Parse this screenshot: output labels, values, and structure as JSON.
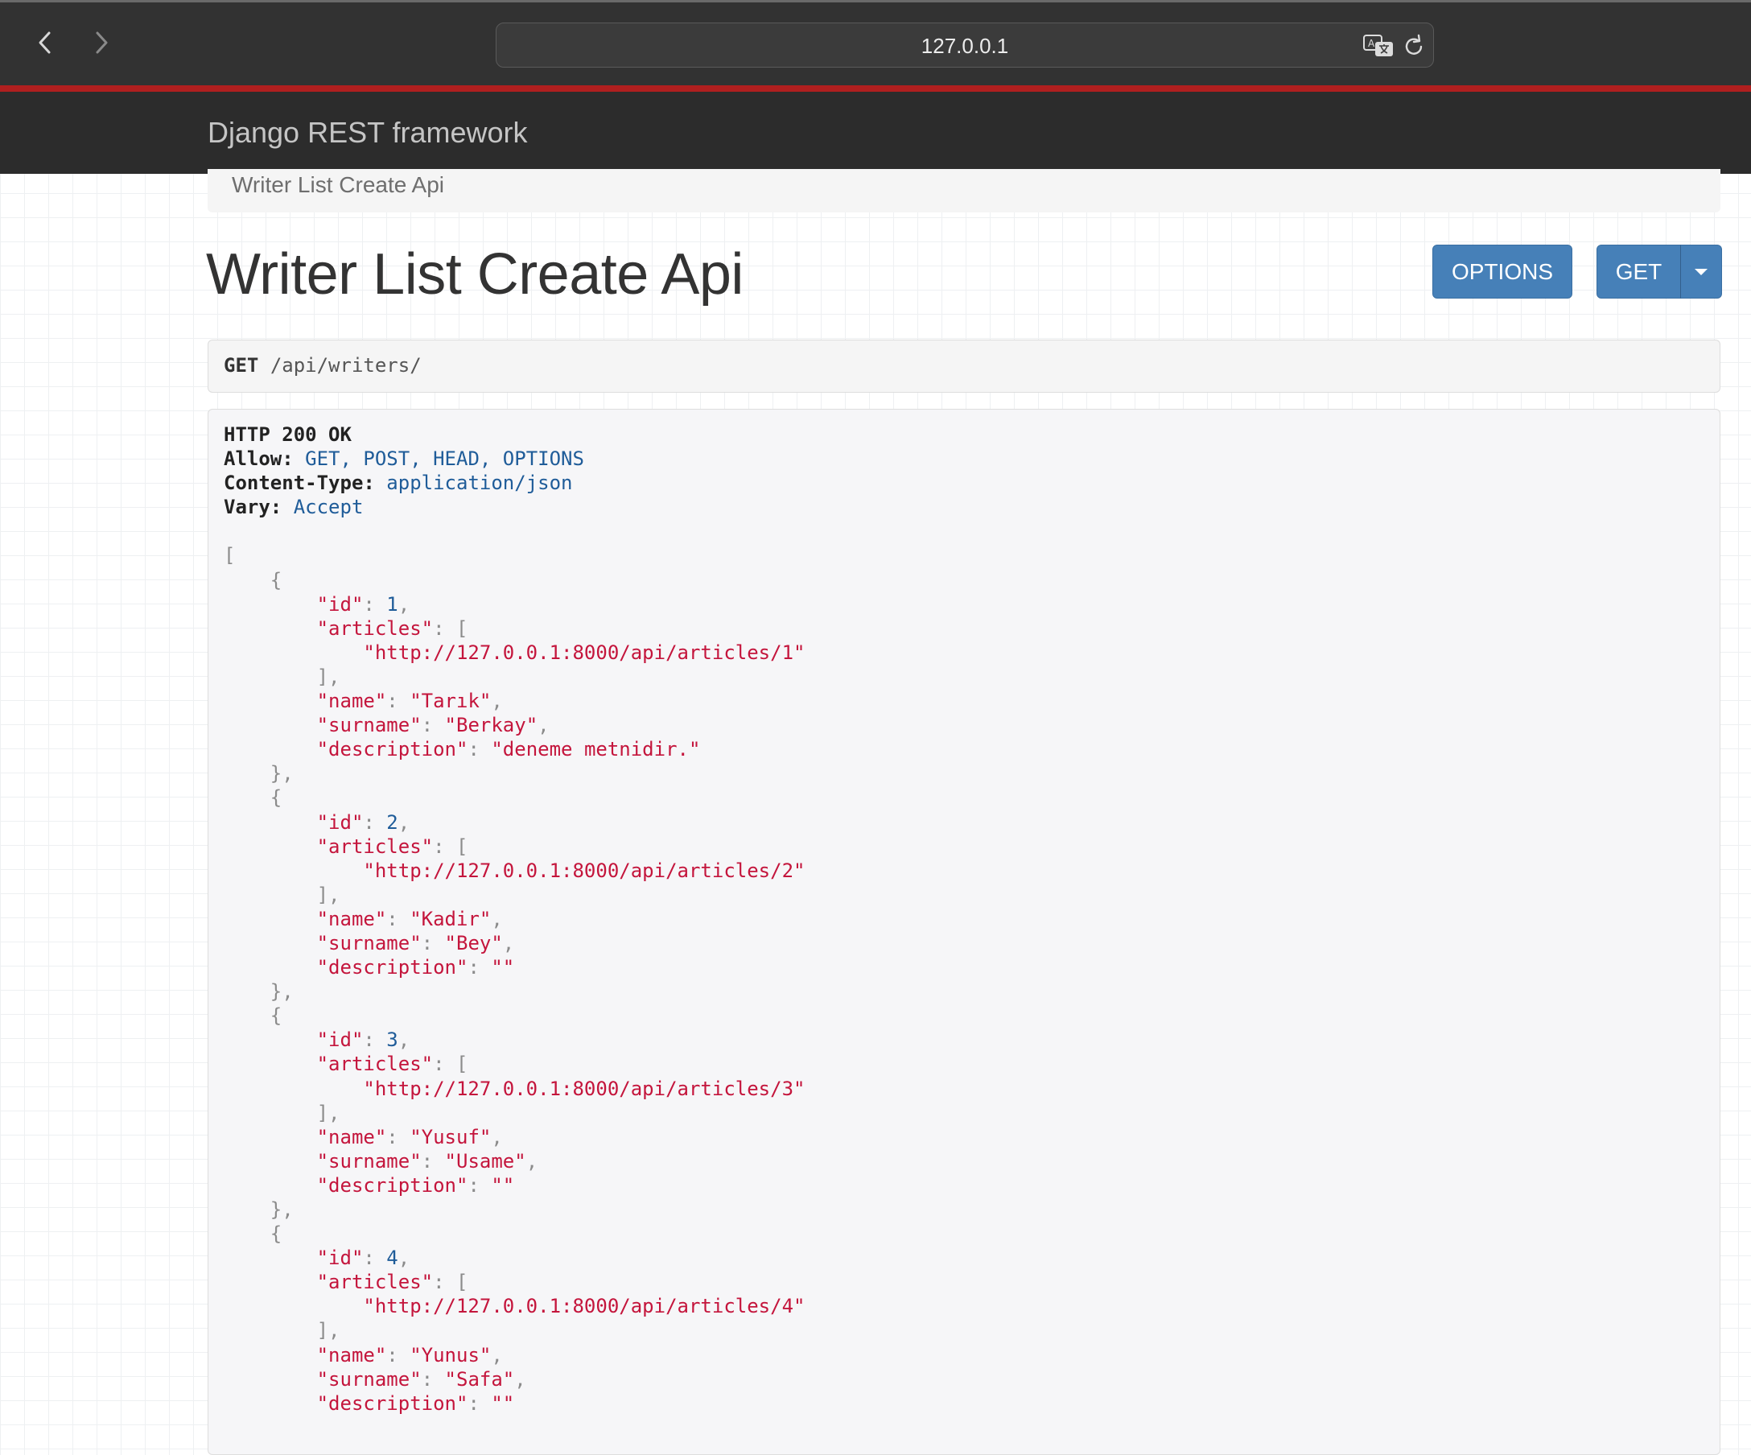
{
  "browser": {
    "url": "127.0.0.1",
    "back_icon": "chevron-left-icon",
    "forward_icon": "chevron-right-icon",
    "translate_icon": "translate-icon",
    "reload_icon": "reload-icon"
  },
  "navbar": {
    "brand": "Django REST framework"
  },
  "breadcrumb": {
    "current": "Writer List Create Api"
  },
  "page": {
    "title": "Writer List Create Api",
    "options_button": "OPTIONS",
    "get_button": "GET",
    "get_dropdown_icon": "caret-down-icon"
  },
  "request": {
    "method": "GET",
    "path": "/api/writers/"
  },
  "response": {
    "status": "HTTP 200 OK",
    "headers": [
      {
        "key": "Allow:",
        "value": "GET, POST, HEAD, OPTIONS"
      },
      {
        "key": "Content-Type:",
        "value": "application/json"
      },
      {
        "key": "Vary:",
        "value": "Accept"
      }
    ],
    "items": [
      {
        "id": "1",
        "article": "\"http://127.0.0.1:8000/api/articles/1\"",
        "name": "\"Tarık\"",
        "surname": "\"Berkay\"",
        "description": "\"deneme metnidir.\""
      },
      {
        "id": "2",
        "article": "\"http://127.0.0.1:8000/api/articles/2\"",
        "name": "\"Kadir\"",
        "surname": "\"Bey\"",
        "description": "\"\""
      },
      {
        "id": "3",
        "article": "\"http://127.0.0.1:8000/api/articles/3\"",
        "name": "\"Yusuf\"",
        "surname": "\"Usame\"",
        "description": "\"\""
      },
      {
        "id": "4",
        "article": "\"http://127.0.0.1:8000/api/articles/4\"",
        "name": "\"Yunus\"",
        "surname": "\"Safa\"",
        "description": "\"\""
      }
    ]
  },
  "colors": {
    "navbar": "#2c2c2c",
    "accent_strip": "#b01f1f",
    "button": "#4680b8",
    "json_key": "#c4153c",
    "json_number": "#1f5c99"
  }
}
